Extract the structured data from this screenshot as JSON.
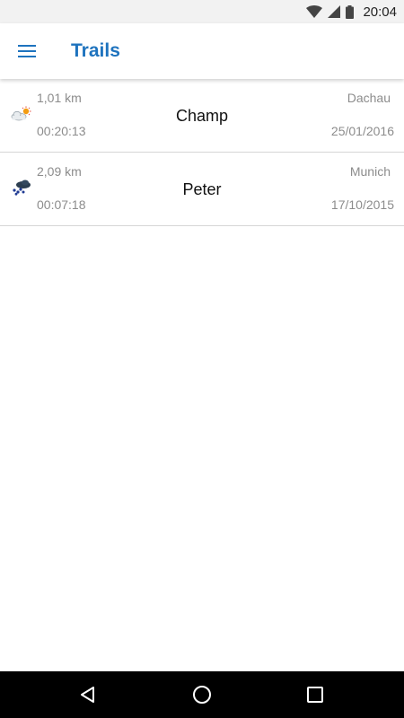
{
  "status_bar": {
    "time": "20:04"
  },
  "app_bar": {
    "title": "Trails"
  },
  "trails": [
    {
      "distance": "1,01 km",
      "duration": "00:20:13",
      "name": "Champ",
      "location": "Dachau",
      "date": "25/01/2016",
      "weather_icon": "partly-cloudy-sun-icon"
    },
    {
      "distance": "2,09 km",
      "duration": "00:07:18",
      "name": "Peter",
      "location": "Munich",
      "date": "17/10/2015",
      "weather_icon": "rain-cloud-icon"
    }
  ],
  "colors": {
    "accent": "#1e73be",
    "secondary_text": "#8c8c8c",
    "divider": "#d6d6d6"
  }
}
